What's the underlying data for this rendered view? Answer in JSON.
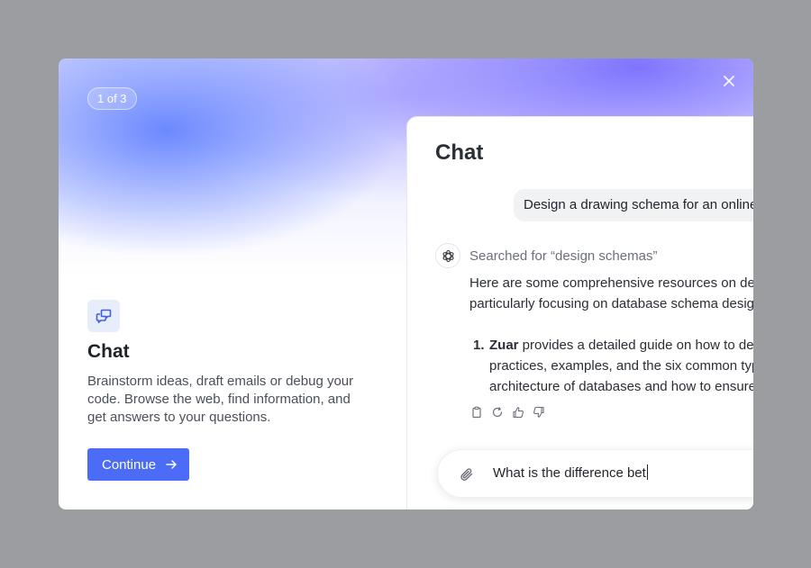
{
  "onboarding": {
    "step_label": "1 of 3",
    "feature": {
      "icon": "chat-bubbles-icon",
      "title": "Chat",
      "description": "Brainstorm ideas, draft emails or debug your code. Browse the web, find information, and get answers to your questions."
    },
    "continue_label": "Continue",
    "accent_color": "#4a6cf7"
  },
  "preview": {
    "title": "Chat",
    "user_message": "Design a drawing schema for an online",
    "ai": {
      "search_note": "Searched for “design schemas”",
      "lines": [
        "Here are some comprehensive resources on designing",
        "particularly focusing on database schema design"
      ],
      "list": [
        {
          "number": "1.",
          "bold": "Zuar",
          "first_line": " provides a detailed guide on how to design",
          "more_lines": [
            "practices, examples, and the six common types of",
            "architecture of databases and how to ensure"
          ]
        }
      ],
      "actions": [
        "copy-icon",
        "regenerate-icon",
        "thumbs-up-icon",
        "thumbs-down-icon"
      ]
    },
    "composer": {
      "value": "What is the difference bet"
    }
  }
}
